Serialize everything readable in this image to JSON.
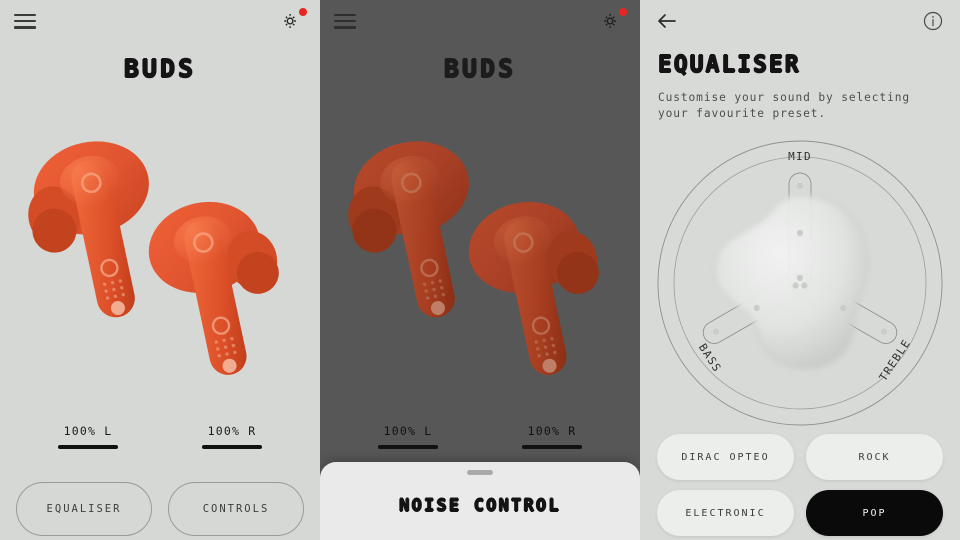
{
  "theme": {
    "light_bg": "#d6d8d6",
    "dark_bg": "#575757",
    "eq_bg": "#d8dad8",
    "accent_bud": "#e0542c",
    "badge_red": "#e8251f",
    "selected_bg": "#0a0a0a",
    "text_dark": "#141414"
  },
  "panel_home": {
    "menu_icon": "hamburger-menu-icon",
    "settings_icon": "gear-icon",
    "settings_badge": true,
    "title": "BUDS",
    "product_image_alt": "orange-wireless-earbuds",
    "battery": [
      {
        "percent": "100%",
        "side": "L",
        "label": "100%  L"
      },
      {
        "percent": "100%",
        "side": "R",
        "label": "100%  R"
      }
    ],
    "buttons": [
      {
        "label": "EQUALISER"
      },
      {
        "label": "CONTROLS"
      }
    ]
  },
  "panel_noise": {
    "menu_icon": "hamburger-menu-icon",
    "settings_icon": "gear-icon",
    "settings_badge": true,
    "title": "BUDS",
    "product_image_alt": "orange-wireless-earbuds-dimmed",
    "battery": [
      {
        "percent": "100%",
        "side": "L",
        "label": "100%  L"
      },
      {
        "percent": "100%",
        "side": "R",
        "label": "100%  R"
      }
    ],
    "sheet": {
      "handle": "drag-handle",
      "title": "NOISE CONTROL"
    }
  },
  "panel_equaliser": {
    "back_icon": "arrow-left-icon",
    "info_icon": "info-circle-icon",
    "title": "EQUALISER",
    "subtitle": "Customise your sound by selecting your favourite preset.",
    "dial": {
      "axes": [
        {
          "name": "MID",
          "angle": -90
        },
        {
          "name": "BASS",
          "angle": 150
        },
        {
          "name": "TREBLE",
          "angle": 30
        }
      ]
    },
    "presets": [
      {
        "label": "DIRAC OPTEO",
        "selected": false
      },
      {
        "label": "ROCK",
        "selected": false
      },
      {
        "label": "ELECTRONIC",
        "selected": false
      },
      {
        "label": "POP",
        "selected": true
      }
    ]
  }
}
